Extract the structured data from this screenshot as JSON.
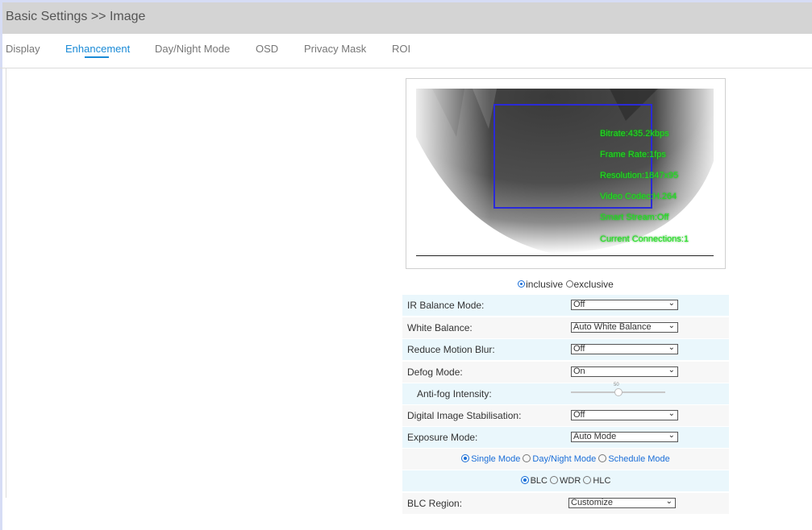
{
  "titlebar": {
    "title": "Basic Settings >> Image"
  },
  "tabs": [
    {
      "label": "Display"
    },
    {
      "label": "Enhancement"
    },
    {
      "label": "Day/Night Mode"
    },
    {
      "label": "OSD"
    },
    {
      "label": "Privacy Mask"
    },
    {
      "label": "ROI"
    }
  ],
  "active_tab": "Enhancement",
  "preview": {
    "osd_lines": [
      "Bitrate:435.2kbps",
      "Frame Rate:1fps",
      "Resolution:1847x95",
      "Video Codec:H.264",
      "Smart Stream:Off",
      "Current Connections:1"
    ]
  },
  "region_mode": {
    "inclusive": "inclusive",
    "exclusive": "exclusive",
    "selected": "inclusive"
  },
  "settings": {
    "ir_balance": {
      "label": "IR Balance Mode:",
      "value": "Off"
    },
    "white_balance": {
      "label": "White Balance:",
      "value": "Auto White Balance"
    },
    "motion_blur": {
      "label": "Reduce Motion Blur:",
      "value": "Off"
    },
    "defog": {
      "label": "Defog Mode:",
      "value": "On"
    },
    "antifog": {
      "label": "Anti-fog Intensity:",
      "value": "50"
    },
    "dis": {
      "label": "Digital Image Stabilisation:",
      "value": "Off"
    },
    "exposure": {
      "label": "Exposure Mode:",
      "value": "Auto Mode"
    },
    "blc_region": {
      "label": "BLC Region:",
      "value": "Customize"
    }
  },
  "schedule_modes": {
    "single": "Single Mode",
    "daynight": "Day/Night Mode",
    "schedule": "Schedule Mode",
    "selected": "Single Mode"
  },
  "backlight_modes": {
    "blc": "BLC",
    "wdr": "WDR",
    "hlc": "HLC",
    "selected": "BLC"
  },
  "colors": {
    "accent": "#1a8ad6",
    "osd": "#22e022",
    "roi": "#2a2ad8"
  }
}
